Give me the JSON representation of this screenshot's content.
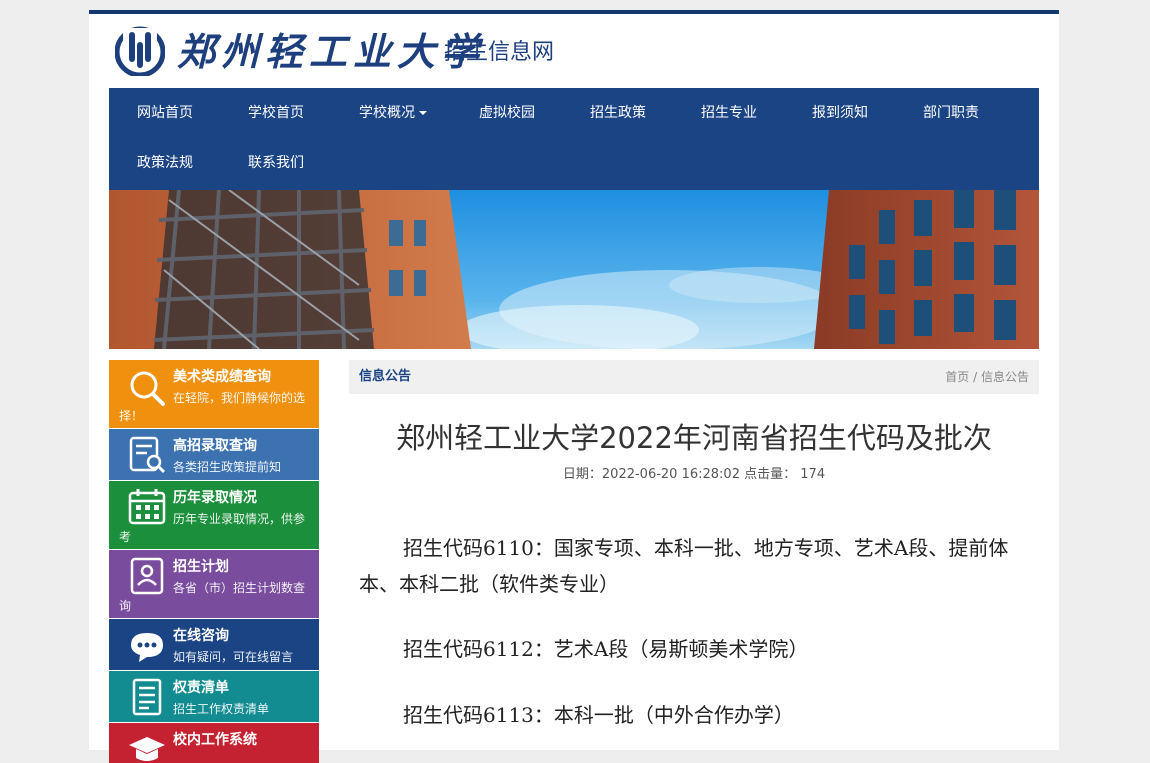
{
  "header": {
    "logo_script": "郑州轻工业大学",
    "subtitle": "招生信息网"
  },
  "nav": {
    "items": [
      {
        "label": "网站首页"
      },
      {
        "label": "学校首页"
      },
      {
        "label": "学校概况",
        "has_dropdown": true
      },
      {
        "label": "虚拟校园"
      },
      {
        "label": "招生政策"
      },
      {
        "label": "招生专业"
      },
      {
        "label": "报到须知"
      },
      {
        "label": "部门职责"
      },
      {
        "label": "政策法规"
      },
      {
        "label": "联系我们"
      }
    ]
  },
  "sidebar": {
    "items": [
      {
        "title": "美术类成绩查询",
        "desc": "在轻院，我们静候你的选择！",
        "color": "#f0900f",
        "icon": "search-icon"
      },
      {
        "title": "高招录取查询",
        "desc": "各类招生政策提前知",
        "color": "#3d72b0",
        "icon": "document-search-icon"
      },
      {
        "title": "历年录取情况",
        "desc": "历年专业录取情况，供参考",
        "color": "#1c8f3c",
        "icon": "calendar-icon"
      },
      {
        "title": "招生计划",
        "desc": "各省（市）招生计划数查询",
        "color": "#7a4c9d",
        "icon": "profile-icon"
      },
      {
        "title": "在线咨询",
        "desc": "如有疑问，可在线留言",
        "color": "#1b4485",
        "icon": "chat-icon"
      },
      {
        "title": "权责清单",
        "desc": "招生工作权责清单",
        "color": "#128c91",
        "icon": "list-icon"
      },
      {
        "title": "校内工作系统",
        "desc": "",
        "color": "#c42230",
        "icon": "graduation-cap-icon"
      }
    ]
  },
  "main": {
    "section_title": "信息公告",
    "breadcrumb": {
      "home": "首页",
      "separator": " / ",
      "current": "信息公告"
    },
    "article": {
      "title": "郑州轻工业大学2022年河南省招生代码及批次",
      "date_label": "日期：",
      "date": "2022-06-20 16:28:02",
      "hits_label": "点击量：",
      "hits": "174",
      "paragraphs": [
        "招生代码6110：国家专项、本科一批、地方专项、艺术A段、提前体本、本科二批（软件类专业）",
        "招生代码6112：艺术A段（易斯顿美术学院）",
        "招生代码6113：本科一批（中外合作办学）"
      ]
    }
  },
  "colors": {
    "brand": "#1b4485",
    "top_border": "#15386f"
  }
}
